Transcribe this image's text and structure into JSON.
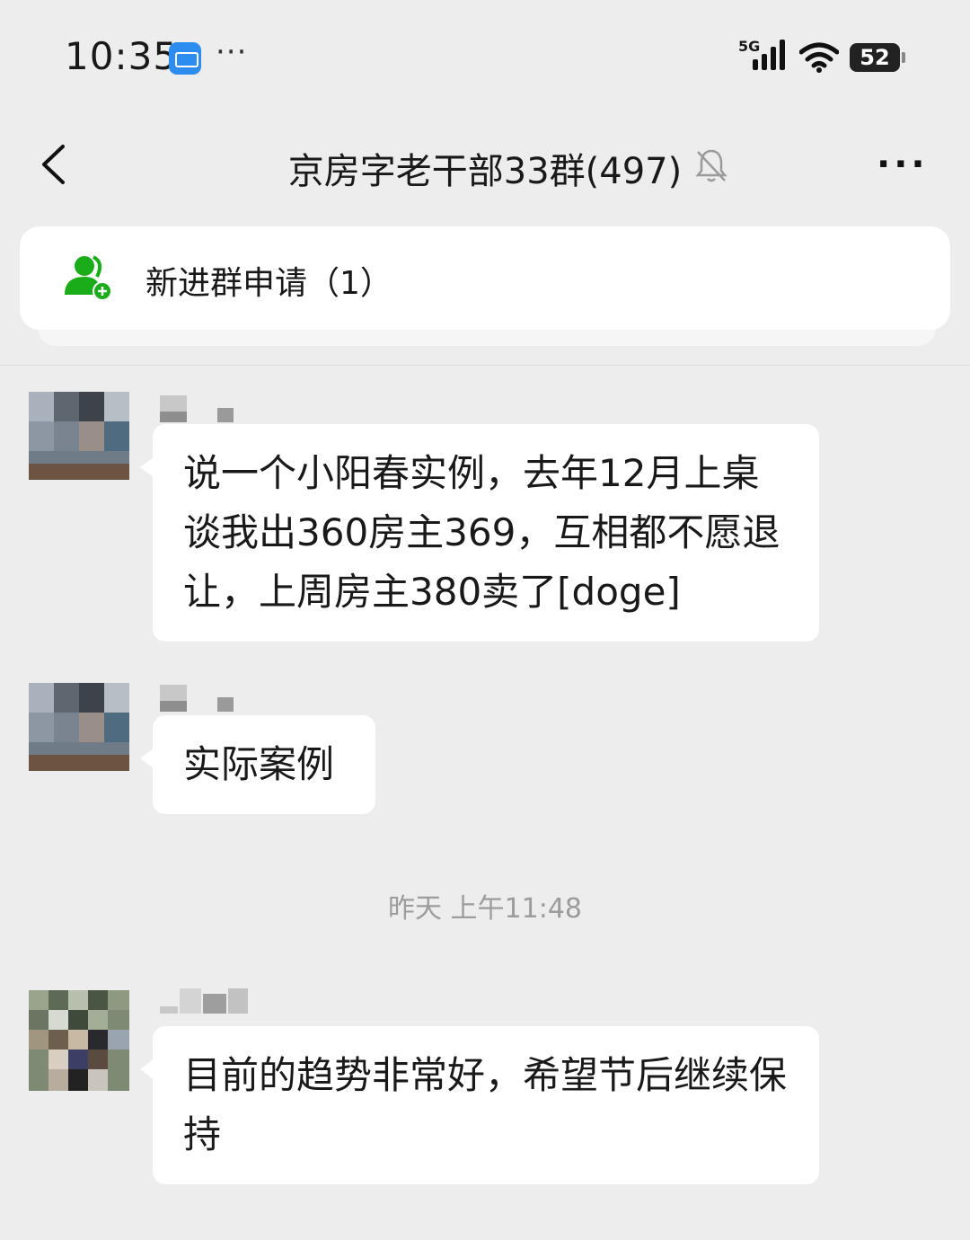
{
  "status_bar": {
    "time": "10:35",
    "network": "5G",
    "battery": "52",
    "icons": [
      "wallet-icon",
      "more-dots-icon",
      "signal-icon",
      "wifi-icon",
      "battery-icon"
    ]
  },
  "header": {
    "title": "京房字老干部33群(497)",
    "icons": [
      "back-icon",
      "mute-bell-icon",
      "more-icon"
    ]
  },
  "notice": {
    "label": "新进群申请（1）",
    "icon": "add-member-icon",
    "accent": "#1aad19"
  },
  "messages": [
    {
      "text": "说一个小阳春实例，去年12月上桌谈我出360房主369，互相都不愿退让，上周房主380卖了[doge]"
    },
    {
      "text": "实际案例"
    },
    {
      "text": "目前的趋势非常好，希望节后继续保持"
    }
  ],
  "timestamp": "昨天 上午11:48",
  "colors": {
    "background": "#ededed",
    "bubble": "#ffffff",
    "text": "#191919",
    "muted": "#9c9c9c"
  }
}
